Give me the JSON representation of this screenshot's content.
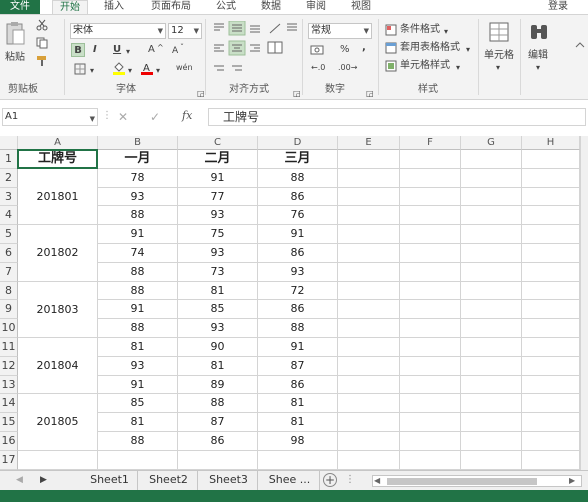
{
  "menu": {
    "file": "文件",
    "tabs": [
      "开始",
      "插入",
      "页面布局",
      "公式",
      "数据",
      "审阅",
      "视图"
    ],
    "login": "登录"
  },
  "ribbon": {
    "clipboard": {
      "paste": "粘贴",
      "label": "剪贴板"
    },
    "font": {
      "name": "宋体",
      "size": "12",
      "bold": "B",
      "italic": "I",
      "underline": "U",
      "grow": "A",
      "shrink": "A",
      "label": "字体",
      "phonetic": "wén"
    },
    "alignment": {
      "label": "对齐方式"
    },
    "number": {
      "format": "常规",
      "percent": "%",
      "comma": ",",
      "label": "数字"
    },
    "styles": {
      "conditional": "条件格式",
      "table": "套用表格格式",
      "cell": "单元格样式",
      "label": "样式"
    },
    "cells": {
      "label": "单元格"
    },
    "editing": {
      "label": "编辑"
    }
  },
  "formula_bar": {
    "name_box": "A1",
    "fx": "fx",
    "value": "工牌号"
  },
  "columns": [
    "A",
    "B",
    "C",
    "D",
    "E",
    "F",
    "G",
    "H"
  ],
  "rows": [
    "1",
    "2",
    "3",
    "4",
    "5",
    "6",
    "7",
    "8",
    "9",
    "10",
    "11",
    "12",
    "13",
    "14",
    "15",
    "16",
    "17"
  ],
  "table": {
    "headers": [
      "工牌号",
      "一月",
      "二月",
      "三月"
    ],
    "groups": [
      {
        "id": "201801",
        "rows": [
          [
            "78",
            "91",
            "88"
          ],
          [
            "93",
            "77",
            "86"
          ],
          [
            "88",
            "93",
            "76"
          ]
        ]
      },
      {
        "id": "201802",
        "rows": [
          [
            "91",
            "75",
            "91"
          ],
          [
            "74",
            "93",
            "86"
          ],
          [
            "88",
            "73",
            "93"
          ]
        ]
      },
      {
        "id": "201803",
        "rows": [
          [
            "88",
            "81",
            "72"
          ],
          [
            "91",
            "85",
            "86"
          ],
          [
            "88",
            "93",
            "88"
          ]
        ]
      },
      {
        "id": "201804",
        "rows": [
          [
            "81",
            "90",
            "91"
          ],
          [
            "93",
            "81",
            "87"
          ],
          [
            "91",
            "89",
            "86"
          ]
        ]
      },
      {
        "id": "201805",
        "rows": [
          [
            "85",
            "88",
            "81"
          ],
          [
            "81",
            "87",
            "81"
          ],
          [
            "88",
            "86",
            "98"
          ]
        ]
      }
    ]
  },
  "sheets": [
    "Sheet1",
    "Sheet2",
    "Sheet3",
    "Shee ..."
  ],
  "colors": {
    "accent": "#217346"
  }
}
